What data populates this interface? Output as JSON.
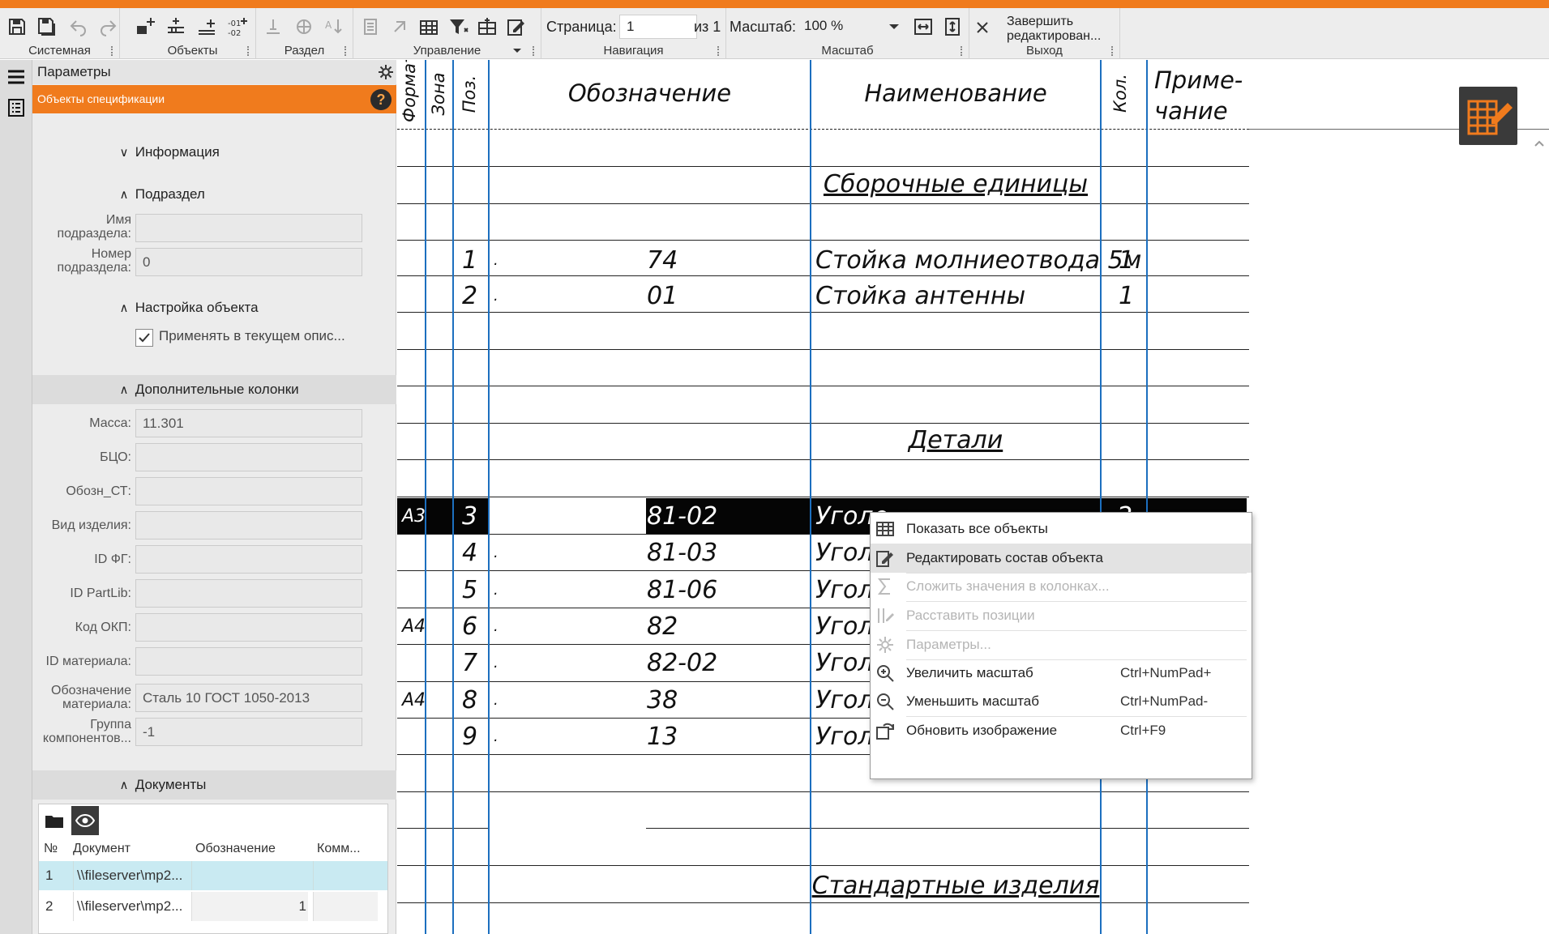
{
  "toolbar": {
    "groups": {
      "system": "Системная",
      "objects": "Объекты",
      "section": "Раздел",
      "control": "Управление",
      "navigation": "Навигация",
      "scale": "Масштаб",
      "exit": "Выход"
    },
    "page_label": "Страница:",
    "page_value": "1",
    "page_of": "из 1",
    "scale_label": "Масштаб:",
    "scale_value": "100 %",
    "exit_line1": "Завершить",
    "exit_line2": "редактирован..."
  },
  "panel": {
    "title": "Параметры",
    "subtitle": "Объекты спецификации",
    "help": "?",
    "sections": {
      "info": "Информация",
      "subsection": "Подраздел",
      "object_settings": "Настройка объекта",
      "extra_columns": "Дополнительные колонки",
      "documents": "Документы"
    },
    "subsection_fields": {
      "name_label_1": "Имя",
      "name_label_2": "подраздела:",
      "name_value": "",
      "number_label_1": "Номер",
      "number_label_2": "подраздела:",
      "number_value": "0"
    },
    "apply_checkbox": "Применять в текущем опис...",
    "extra_fields": [
      {
        "label": "Масса:",
        "value": "11.301"
      },
      {
        "label": "БЦО:",
        "value": ""
      },
      {
        "label": "Обозн_СТ:",
        "value": ""
      },
      {
        "label": "Вид изделия:",
        "value": ""
      },
      {
        "label": "ID ФГ:",
        "value": ""
      },
      {
        "label": "ID PartLib:",
        "value": ""
      },
      {
        "label": "Код ОКП:",
        "value": ""
      },
      {
        "label": "ID материала:",
        "value": ""
      }
    ],
    "material": {
      "label_1": "Обозначение",
      "label_2": "материала:",
      "value": "Сталь 10  ГОСТ 1050-2013"
    },
    "group": {
      "label_1": "Группа",
      "label_2": "компонентов...",
      "value": "-1"
    },
    "documents_table": {
      "headers": [
        "№",
        "Документ",
        "Обозначение",
        "Комм..."
      ],
      "rows": [
        {
          "n": "1",
          "doc": "\\\\fileserver\\mp2...",
          "designation": "",
          "comment": ""
        },
        {
          "n": "2",
          "doc": "\\\\fileserver\\mp2...",
          "designation": "1",
          "comment": ""
        }
      ]
    }
  },
  "spec": {
    "headers": {
      "format": "Формат",
      "zone": "Зона",
      "pos": "Поз.",
      "designation": "Обозначение",
      "name": "Наименование",
      "qty": "Кол.",
      "note_1": "Приме-",
      "note_2": "чание"
    },
    "section_assembly": "Сборочные единицы",
    "section_details": "Детали",
    "section_standard": "Стандартные изделия",
    "assembly_rows": [
      {
        "pos": "1",
        "designation": "74",
        "name": "Стойка молниеотвода 5м",
        "qty": "1"
      },
      {
        "pos": "2",
        "designation": "01",
        "name": "Стойка антенны",
        "qty": "1"
      }
    ],
    "detail_rows": [
      {
        "format": "А3",
        "pos": "3",
        "designation": "81-02",
        "name": "Уголо",
        "qty": "2"
      },
      {
        "format": "",
        "pos": "4",
        "designation": "81-03",
        "name": "Уголо",
        "qty": ""
      },
      {
        "format": "",
        "pos": "5",
        "designation": "81-06",
        "name": "Уголо",
        "qty": ""
      },
      {
        "format": "А4",
        "pos": "6",
        "designation": "82",
        "name": "Уголо",
        "qty": ""
      },
      {
        "format": "",
        "pos": "7",
        "designation": "82-02",
        "name": "Уголо",
        "qty": ""
      },
      {
        "format": "А4",
        "pos": "8",
        "designation": "38",
        "name": "Уголо",
        "qty": ""
      },
      {
        "format": "",
        "pos": "9",
        "designation": "13",
        "name": "Уголо",
        "qty": ""
      }
    ],
    "dot": "."
  },
  "context_menu": {
    "items": [
      {
        "label": "Показать все объекты",
        "shortcut": "",
        "disabled": false
      },
      {
        "label": "Редактировать состав объекта",
        "shortcut": "",
        "disabled": false
      },
      {
        "label": "Сложить значения в колонках...",
        "shortcut": "",
        "disabled": true
      },
      {
        "label": "Расставить позиции",
        "shortcut": "",
        "disabled": true
      },
      {
        "label": "Параметры...",
        "shortcut": "",
        "disabled": true
      },
      {
        "label": "Увеличить масштаб",
        "shortcut": "Ctrl+NumPad+",
        "disabled": false
      },
      {
        "label": "Уменьшить масштаб",
        "shortcut": "Ctrl+NumPad-",
        "disabled": false
      },
      {
        "label": "Обновить изображение",
        "shortcut": "Ctrl+F9",
        "disabled": false
      }
    ]
  },
  "colors": {
    "accent": "#f07b1d",
    "column_line": "#1c6fbf",
    "selected_row": "#050505"
  },
  "icons": [
    "save-icon",
    "save-all-icon",
    "undo-icon",
    "redo-icon",
    "add-object-icon",
    "add-section-icon",
    "add-row-icon",
    "numbering-icon",
    "settings-gear-icon",
    "help-icon",
    "edit-spec-icon",
    "fit-width-icon",
    "fit-height-icon",
    "close-icon",
    "dropdown-icon",
    "folder-icon",
    "eye-icon"
  ]
}
